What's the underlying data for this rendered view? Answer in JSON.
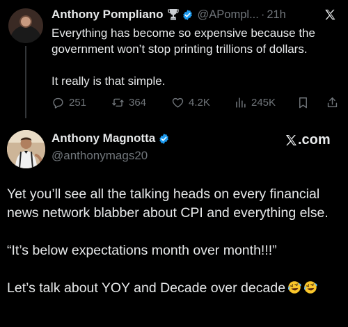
{
  "tweet1": {
    "author_name": "Anthony Pompliano",
    "handle": "@APompl...",
    "separator": "·",
    "time": "21h",
    "paragraphs": [
      "Everything has become so expensive because the government won’t stop printing trillions of dollars.",
      "It really is that simple."
    ],
    "stats": {
      "replies": "251",
      "reposts": "364",
      "likes": "4.2K",
      "views": "245K"
    }
  },
  "tweet2": {
    "author_name": "Anthony Magnotta",
    "handle": "@anthonymags20",
    "brand_label": ".com",
    "paragraphs": [
      "Yet you’ll see all the talking heads on every financial news network blabber about CPI and everything else.",
      "“It’s below expectations month over month!!!”",
      "Let’s talk about YOY and Decade over decade"
    ]
  },
  "colors": {
    "background": "#000000",
    "text": "#e7e9ea",
    "muted": "#71767b",
    "verified_blue": "#1d9bf0",
    "thread_line": "#333639"
  },
  "icons": {
    "reply": "speech-bubble-icon",
    "repost": "repost-arrows-icon",
    "like": "heart-icon",
    "views": "bar-chart-icon",
    "bookmark": "bookmark-icon",
    "share": "share-icon",
    "close": "x-logo-icon",
    "laugh": "rofl-emoji-icon"
  }
}
